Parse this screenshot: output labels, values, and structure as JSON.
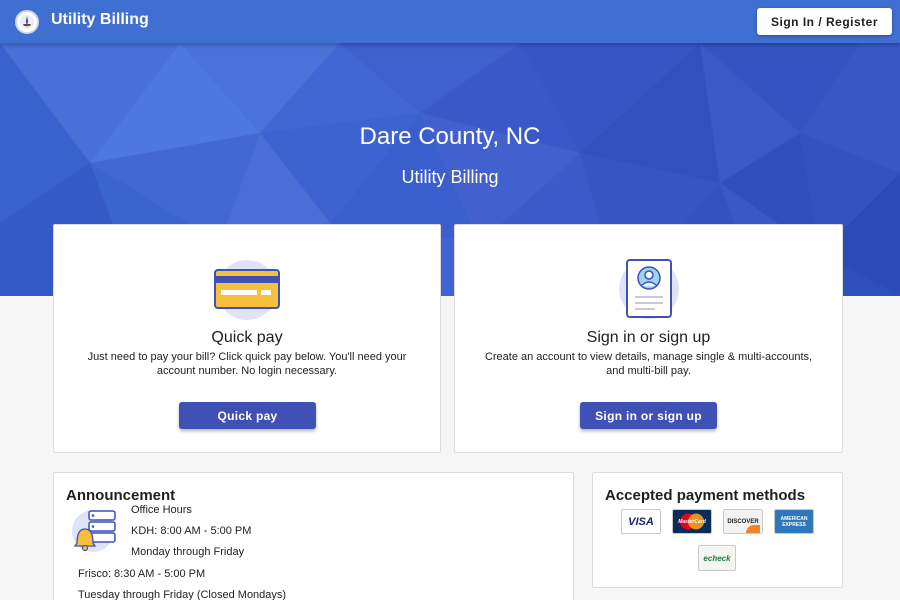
{
  "header": {
    "app_title": "Utility Billing",
    "signin_label": "Sign In / Register"
  },
  "hero": {
    "title": "Dare County, NC",
    "subtitle": "Utility Billing"
  },
  "quick_pay": {
    "title": "Quick pay",
    "description": "Just need to pay your bill? Click quick pay below. You'll need your account number. No login necessary.",
    "button_label": "Quick pay"
  },
  "sign_in": {
    "title": "Sign in or sign up",
    "description": "Create an account to view details, manage single & multi-accounts, and multi-bill pay.",
    "button_label": "Sign in or sign up"
  },
  "announcement": {
    "title": "Announcement",
    "lines": [
      "Office Hours",
      "KDH: 8:00 AM - 5:00 PM",
      "Monday through Friday",
      "Frisco: 8:30 AM - 5:00 PM",
      "Tuesday through Friday (Closed Mondays)"
    ]
  },
  "payment_methods": {
    "title": "Accepted payment methods",
    "logos": [
      {
        "name": "visa",
        "text": "VISA"
      },
      {
        "name": "mastercard",
        "text": "MasterCard"
      },
      {
        "name": "discover",
        "text": "DISCOVER"
      },
      {
        "name": "american-express",
        "text": "AMERICAN EXPRESS"
      },
      {
        "name": "echeck",
        "text": "echeck"
      }
    ]
  },
  "colors": {
    "topbar": "#3f6fd0",
    "hero": "#3e66d4",
    "button": "#3f51b5",
    "card_icon_yellow": "#f7c03c"
  }
}
